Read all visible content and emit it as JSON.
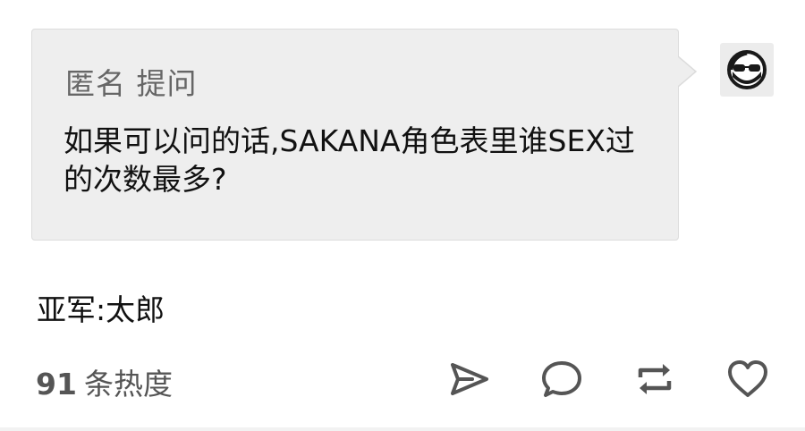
{
  "ask": {
    "asker": "匿名",
    "action": "提问",
    "question": "如果可以问的话,SAKANA角色表里谁SEX过的次数最多?"
  },
  "avatar": {
    "icon": "sunglasses-face-icon"
  },
  "answer": {
    "text": "亚军:太郎"
  },
  "footer": {
    "notes_count": "91",
    "notes_label": "条热度",
    "icons": [
      "share-icon",
      "reply-icon",
      "reblog-icon",
      "like-icon"
    ]
  },
  "colors": {
    "bubble_bg": "#eeeeee",
    "icon_color": "#555555",
    "text": "#111111"
  }
}
